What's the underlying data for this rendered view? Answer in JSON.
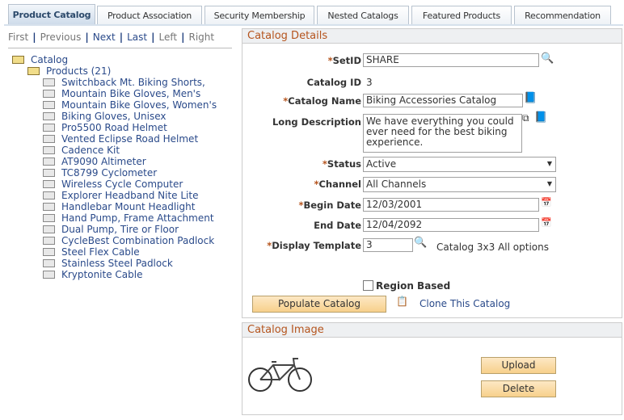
{
  "tabs": [
    "Product Catalog",
    "Product Association",
    "Security Membership",
    "Nested Catalogs",
    "Featured Products",
    "Recommendation"
  ],
  "nav": {
    "first": "First",
    "previous": "Previous",
    "next": "Next",
    "last": "Last",
    "left": "Left",
    "right": "Right"
  },
  "tree": {
    "root": "Catalog",
    "products": "Products (21)",
    "items": [
      "Switchback Mt. Biking Shorts,",
      "Mountain Bike Gloves, Men's",
      "Mountain Bike Gloves, Women's",
      "Biking Gloves, Unisex",
      "Pro5500 Road Helmet",
      "Vented Eclipse Road Helmet",
      "Cadence Kit",
      "AT9090 Altimeter",
      "TC8799 Cyclometer",
      "Wireless Cycle Computer",
      "Explorer Headband Nite Lite",
      "Handlebar Mount Headlight",
      "Hand Pump, Frame Attachment",
      "Dual Pump, Tire or Floor",
      "CycleBest Combination Padlock",
      "Steel Flex Cable",
      "Stainless Steel Padlock",
      "Kryptonite Cable"
    ]
  },
  "details": {
    "title": "Catalog Details",
    "setid_label": "SetID",
    "setid": "SHARE",
    "catalog_id_label": "Catalog ID",
    "catalog_id": "3",
    "name_label": "Catalog Name",
    "name": "Biking Accessories Catalog",
    "desc_label": "Long Description",
    "desc": "We have everything you could ever need for the best biking experience.",
    "status_label": "Status",
    "status": "Active",
    "channel_label": "Channel",
    "channel": "All Channels",
    "begin_label": "Begin Date",
    "begin": "12/03/2001",
    "end_label": "End Date",
    "end": "12/04/2092",
    "template_label": "Display Template",
    "template": "3",
    "template_desc": "Catalog 3x3 All options",
    "region_label": "Region Based",
    "populate": "Populate Catalog",
    "clone": "Clone This Catalog"
  },
  "image": {
    "title": "Catalog Image",
    "upload": "Upload",
    "delete": "Delete"
  }
}
